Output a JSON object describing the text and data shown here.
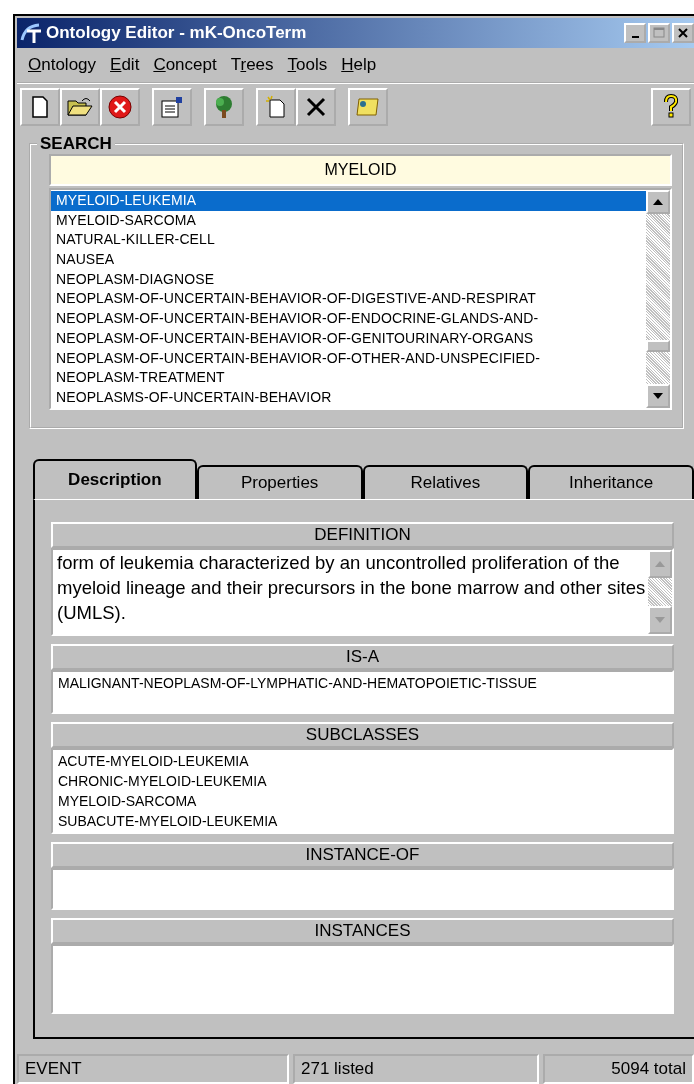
{
  "window": {
    "title": "Ontology Editor - mK-OncoTerm"
  },
  "menu": [
    {
      "key": "O",
      "after": "ntology"
    },
    {
      "key": "E",
      "after": "dit"
    },
    {
      "key": "C",
      "after": "oncept"
    },
    {
      "before": "T",
      "key": "r",
      "after": "ees"
    },
    {
      "key": "T",
      "after": "ools"
    },
    {
      "key": "H",
      "after": "elp"
    }
  ],
  "toolbar": [
    [
      {
        "kind": "new"
      },
      {
        "kind": "open"
      },
      {
        "kind": "stop"
      }
    ],
    [
      {
        "kind": "properties"
      }
    ],
    [
      {
        "kind": "tree"
      }
    ],
    [
      {
        "kind": "new-item"
      },
      {
        "kind": "delete"
      }
    ],
    [
      {
        "kind": "image"
      }
    ],
    [
      {
        "kind": "help"
      }
    ]
  ],
  "search": {
    "label": "SEARCH",
    "value": "MYELOID",
    "results": [
      {
        "text": "MYELOID-LEUKEMIA",
        "selected": true
      },
      {
        "text": "MYELOID-SARCOMA",
        "selected": false
      },
      {
        "text": "NATURAL-KILLER-CELL",
        "selected": false
      },
      {
        "text": "NAUSEA",
        "selected": false
      },
      {
        "text": "NEOPLASM-DIAGNOSE",
        "selected": false
      },
      {
        "text": "NEOPLASM-OF-UNCERTAIN-BEHAVIOR-OF-DIGESTIVE-AND-RESPIRAT",
        "selected": false
      },
      {
        "text": "NEOPLASM-OF-UNCERTAIN-BEHAVIOR-OF-ENDOCRINE-GLANDS-AND-",
        "selected": false
      },
      {
        "text": "NEOPLASM-OF-UNCERTAIN-BEHAVIOR-OF-GENITOURINARY-ORGANS",
        "selected": false
      },
      {
        "text": "NEOPLASM-OF-UNCERTAIN-BEHAVIOR-OF-OTHER-AND-UNSPECIFIED-",
        "selected": false
      },
      {
        "text": "NEOPLASM-TREATMENT",
        "selected": false
      },
      {
        "text": "NEOPLASMS-OF-UNCERTAIN-BEHAVIOR",
        "selected": false
      }
    ]
  },
  "tabs": [
    {
      "label": "Description",
      "selected": true
    },
    {
      "label": "Properties",
      "selected": false
    },
    {
      "label": "Relatives",
      "selected": false
    },
    {
      "label": "Inheritance",
      "selected": false
    }
  ],
  "sections": [
    {
      "title": "DEFINITION",
      "kind": "text",
      "text": "form of leukemia characterized by an uncontrolled proliferation of the myeloid lineage and their precursors in the bone marrow and other sites (UMLS)."
    },
    {
      "title": "IS-A",
      "kind": "list",
      "items": [
        "MALIGNANT-NEOPLASM-OF-LYMPHATIC-AND-HEMATOPOIETIC-TISSUE"
      ]
    },
    {
      "title": "SUBCLASSES",
      "kind": "list",
      "items": [
        "ACUTE-MYELOID-LEUKEMIA",
        "CHRONIC-MYELOID-LEUKEMIA",
        "MYELOID-SARCOMA",
        "SUBACUTE-MYELOID-LEUKEMIA"
      ]
    },
    {
      "title": "INSTANCE-OF",
      "kind": "list"
    },
    {
      "title": "INSTANCES",
      "kind": "list"
    }
  ],
  "status_bar": [
    "EVENT",
    "271 listed",
    "5094 total"
  ]
}
